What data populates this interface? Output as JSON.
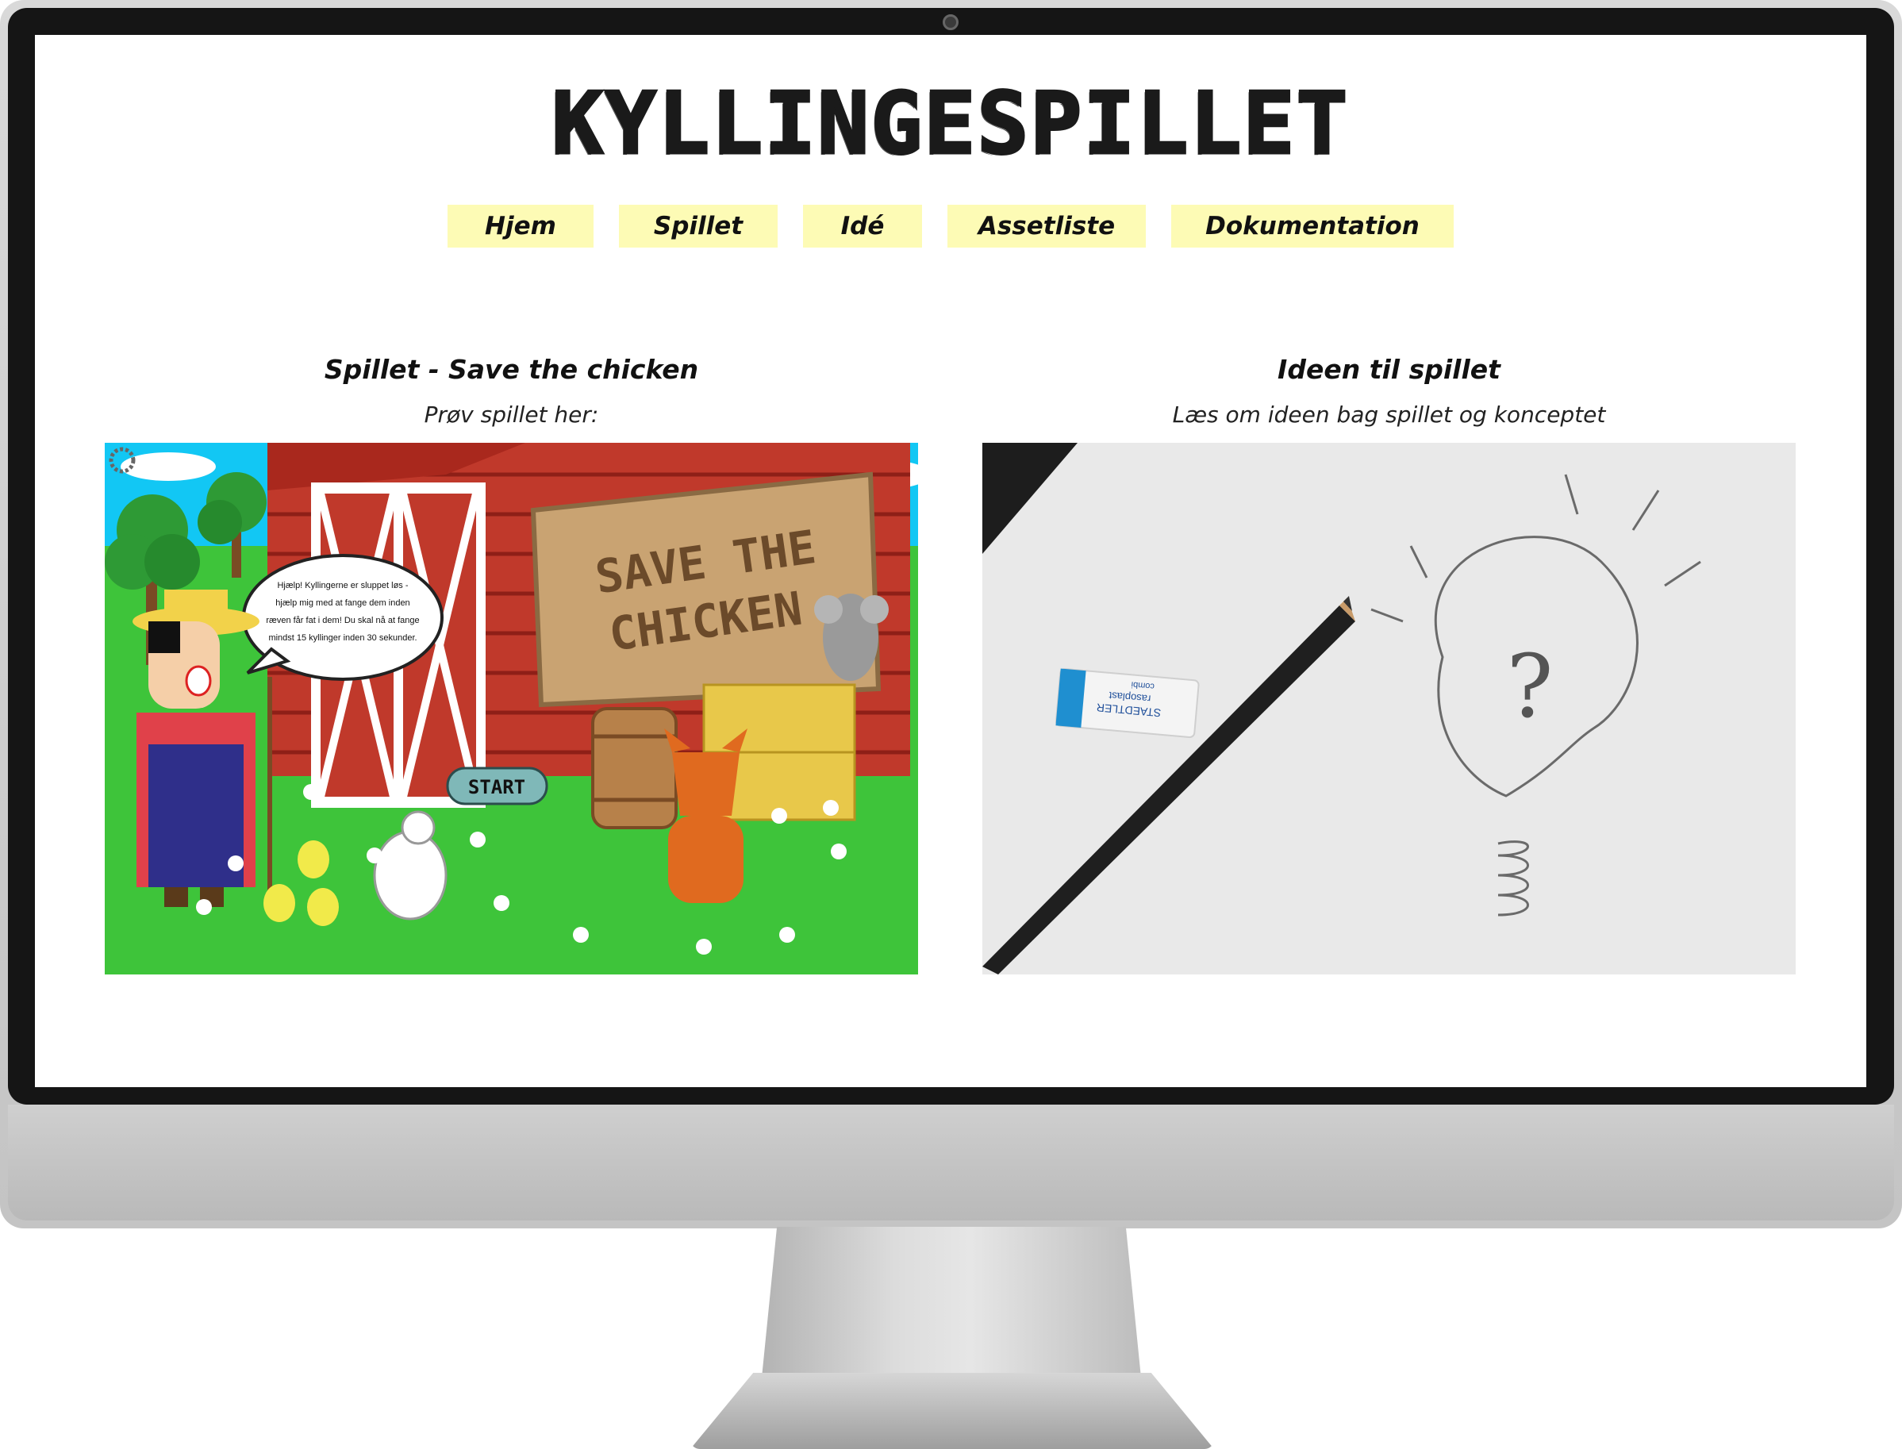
{
  "site": {
    "title": "KYLLINGESPILLET"
  },
  "nav": {
    "items": [
      "Hjem",
      "Spillet",
      "Idé",
      "Assetliste",
      "Dokumentation"
    ]
  },
  "left_section": {
    "heading": "Spillet - Save the chicken",
    "subtext": "Prøv spillet her:",
    "game": {
      "sign_line1": "SAVE THE",
      "sign_line2": "CHICKEN",
      "speech_lines": [
        "Hjælp! Kyllingerne er sluppet løs -",
        "hjælp mig med at fange dem inden",
        "ræven får fat i dem! Du skal nå at fange",
        "mindst 15 kyllinger inden 30 sekunder."
      ],
      "start_label": "START"
    }
  },
  "right_section": {
    "heading": "Ideen til spillet",
    "subtext": "Læs om ideen bag spillet og konceptet",
    "photo": {
      "question_mark": "?",
      "eraser_brand": "STAEDTLER",
      "eraser_model": "rasoplast",
      "eraser_sub": "combi"
    }
  },
  "colors": {
    "nav_bg": "#fdfbb5",
    "barn_red": "#c0392b",
    "grass": "#3ec43a",
    "sky": "#12c7f4"
  }
}
